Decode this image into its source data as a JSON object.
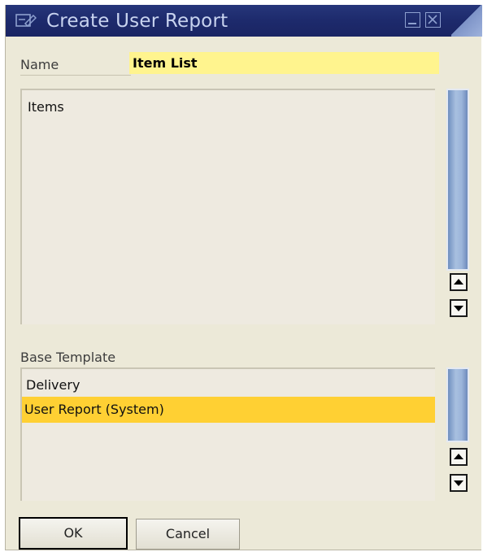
{
  "window": {
    "title": "Create User Report",
    "icons": [
      "document-edit-icon",
      "minimize-icon",
      "close-icon"
    ]
  },
  "name_field": {
    "label": "Name",
    "value": "Item List"
  },
  "items_list": {
    "entries": [
      "Items"
    ]
  },
  "base_template": {
    "label": "Base Template",
    "entries": [
      "Delivery",
      "User Report (System)"
    ],
    "selected": "User Report (System)"
  },
  "buttons": {
    "ok": "OK",
    "cancel": "Cancel"
  },
  "colors": {
    "titlebar": "#1d2a6c",
    "window_bg": "#ece9d8",
    "name_field_bg": "#fff48e",
    "selection": "#ffd033"
  }
}
